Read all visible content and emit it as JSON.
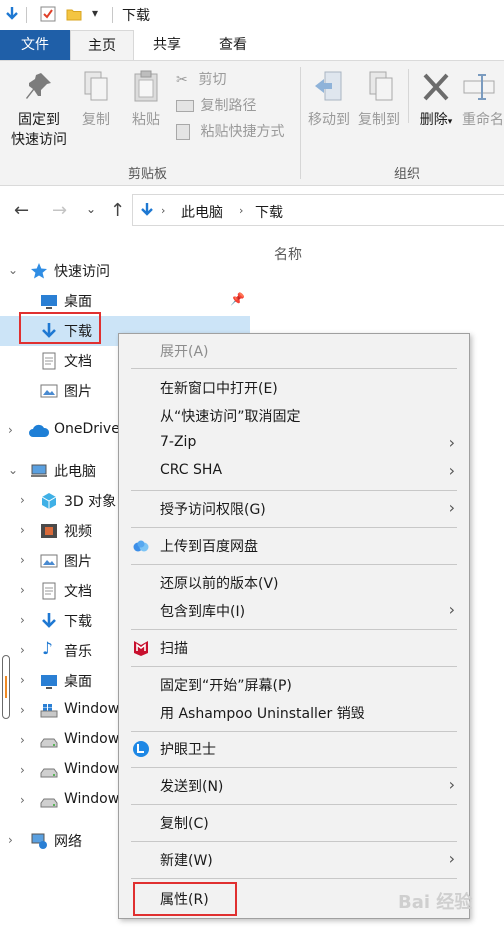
{
  "window": {
    "title": "下载"
  },
  "ribbon_tabs": [
    "文件",
    "主页",
    "共享",
    "查看"
  ],
  "ribbon": {
    "pin_line1": "固定到",
    "pin_line2": "快速访问",
    "copy": "复制",
    "paste": "粘贴",
    "cut": "剪切",
    "copy_path": "复制路径",
    "paste_shortcut": "粘贴快捷方式",
    "clipboard_group": "剪贴板",
    "move_to": "移动到",
    "copy_to": "复制到",
    "delete": "删除",
    "rename": "重命名",
    "organize_group": "组织"
  },
  "address": {
    "crumbs": [
      "此电脑",
      "下载"
    ]
  },
  "content": {
    "column_name": "名称"
  },
  "nav_tree": [
    {
      "label": "快速访问",
      "icon": "star-icon",
      "level": 0,
      "expanded": true
    },
    {
      "label": "桌面",
      "icon": "desktop-icon",
      "level": 1,
      "pinned": true
    },
    {
      "label": "下载",
      "icon": "download-icon",
      "level": 1,
      "pinned": true,
      "selected": true
    },
    {
      "label": "文档",
      "icon": "document-icon",
      "level": 1
    },
    {
      "label": "图片",
      "icon": "picture-icon",
      "level": 1
    },
    {
      "label": "OneDrive",
      "icon": "cloud-icon",
      "level": 0,
      "expanded": false
    },
    {
      "label": "此电脑",
      "icon": "computer-icon",
      "level": 0,
      "expanded": true
    },
    {
      "label": "3D 对象",
      "icon": "cube-icon",
      "level": 1
    },
    {
      "label": "视频",
      "icon": "video-icon",
      "level": 1
    },
    {
      "label": "图片",
      "icon": "picture-icon",
      "level": 1
    },
    {
      "label": "文档",
      "icon": "document-icon",
      "level": 1
    },
    {
      "label": "下载",
      "icon": "download-icon",
      "level": 1
    },
    {
      "label": "音乐",
      "icon": "music-icon",
      "level": 1
    },
    {
      "label": "桌面",
      "icon": "desktop-icon",
      "level": 1
    },
    {
      "label": "Window",
      "icon": "windows-drive-icon",
      "level": 1
    },
    {
      "label": "Window",
      "icon": "drive-icon",
      "level": 1
    },
    {
      "label": "Window",
      "icon": "drive-icon",
      "level": 1
    },
    {
      "label": "Window",
      "icon": "drive-icon",
      "level": 1
    },
    {
      "label": "网络",
      "icon": "network-icon",
      "level": 0,
      "expanded": false
    }
  ],
  "context_menu": [
    {
      "label": "展开(A)",
      "disabled": true
    },
    {
      "label": "在新窗口中打开(E)"
    },
    {
      "label": "从“快速访问”取消固定"
    },
    {
      "label": "7-Zip",
      "submenu": true
    },
    {
      "label": "CRC SHA",
      "submenu": true
    },
    {
      "label": "授予访问权限(G)",
      "submenu": true
    },
    {
      "label": "上传到百度网盘",
      "icon": "baidu-netdisk-icon"
    },
    {
      "label": "还原以前的版本(V)"
    },
    {
      "label": "包含到库中(I)",
      "submenu": true
    },
    {
      "label": "扫描",
      "icon": "mcafee-icon"
    },
    {
      "label": "固定到“开始”屏幕(P)"
    },
    {
      "label": "用 Ashampoo Uninstaller 销毁"
    },
    {
      "label": "护眼卫士",
      "icon": "eye-guard-icon"
    },
    {
      "label": "发送到(N)",
      "submenu": true
    },
    {
      "label": "复制(C)"
    },
    {
      "label": "新建(W)",
      "submenu": true
    },
    {
      "label": "属性(R)",
      "highlighted": true
    }
  ],
  "watermark": "Bai 经验",
  "colors": {
    "file_tab": "#1f5fa8",
    "selection": "#cce4f7",
    "highlight_box": "#e03030",
    "accent_blue": "#1e88e5"
  }
}
